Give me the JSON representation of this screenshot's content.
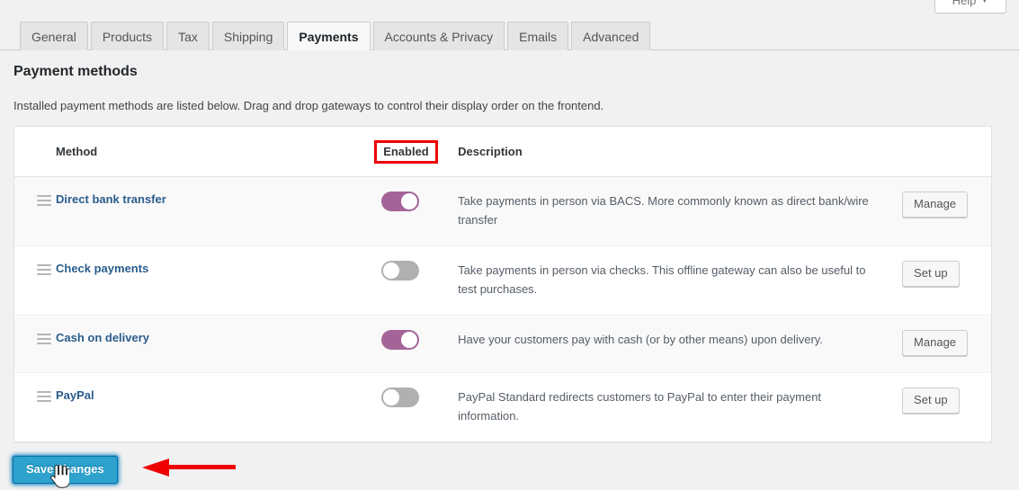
{
  "help": {
    "label": "Help",
    "caret": "▼",
    "icon": "chevron-down-icon"
  },
  "tabs": [
    {
      "label": "General",
      "active": false
    },
    {
      "label": "Products",
      "active": false
    },
    {
      "label": "Tax",
      "active": false
    },
    {
      "label": "Shipping",
      "active": false
    },
    {
      "label": "Payments",
      "active": true
    },
    {
      "label": "Accounts & Privacy",
      "active": false
    },
    {
      "label": "Emails",
      "active": false
    },
    {
      "label": "Advanced",
      "active": false
    }
  ],
  "page": {
    "title": "Payment methods",
    "description": "Installed payment methods are listed below. Drag and drop gateways to control their display order on the frontend."
  },
  "table": {
    "headers": {
      "sort": "",
      "method": "Method",
      "enabled": "Enabled",
      "description": "Description",
      "action": ""
    },
    "rows": [
      {
        "method": "Direct bank transfer",
        "enabled": true,
        "description": "Take payments in person via BACS. More commonly known as direct bank/wire transfer",
        "action": "Manage"
      },
      {
        "method": "Check payments",
        "enabled": false,
        "description": "Take payments in person via checks. This offline gateway can also be useful to test purchases.",
        "action": "Set up"
      },
      {
        "method": "Cash on delivery",
        "enabled": true,
        "description": "Have your customers pay with cash (or by other means) upon delivery.",
        "action": "Manage"
      },
      {
        "method": "PayPal",
        "enabled": false,
        "description": "PayPal Standard redirects customers to PayPal to enter their payment information.",
        "action": "Set up"
      }
    ]
  },
  "footer": {
    "save_label": "Save changes"
  },
  "annotations": {
    "color": "#ee0000",
    "enabled_highlight": "Enabled",
    "arrow_direction": "left",
    "arrow_points_to": "Save changes"
  },
  "colors": {
    "toggle_on": "#a46497",
    "toggle_off": "#b0b0b0",
    "link": "#2a5d8c",
    "save_button": "#2ea2cc",
    "annotation_red": "#ee0000",
    "page_background": "#f1f1f1"
  }
}
